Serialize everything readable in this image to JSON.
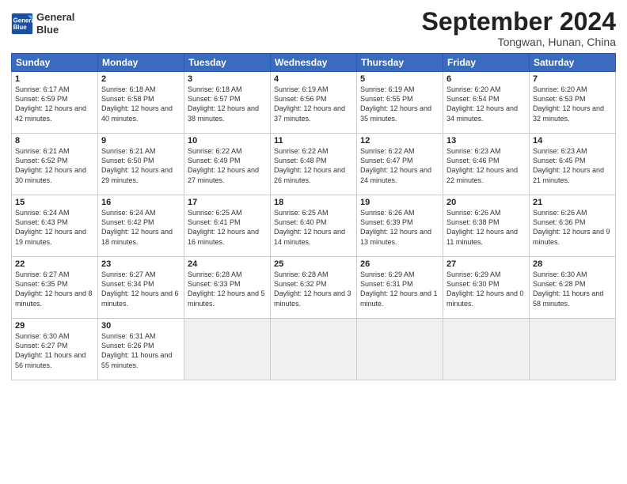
{
  "header": {
    "logo_line1": "General",
    "logo_line2": "Blue",
    "month_title": "September 2024",
    "location": "Tongwan, Hunan, China"
  },
  "days_of_week": [
    "Sunday",
    "Monday",
    "Tuesday",
    "Wednesday",
    "Thursday",
    "Friday",
    "Saturday"
  ],
  "weeks": [
    [
      {
        "day": "1",
        "sunrise": "6:17 AM",
        "sunset": "6:59 PM",
        "daylight": "12 hours and 42 minutes."
      },
      {
        "day": "2",
        "sunrise": "6:18 AM",
        "sunset": "6:58 PM",
        "daylight": "12 hours and 40 minutes."
      },
      {
        "day": "3",
        "sunrise": "6:18 AM",
        "sunset": "6:57 PM",
        "daylight": "12 hours and 38 minutes."
      },
      {
        "day": "4",
        "sunrise": "6:19 AM",
        "sunset": "6:56 PM",
        "daylight": "12 hours and 37 minutes."
      },
      {
        "day": "5",
        "sunrise": "6:19 AM",
        "sunset": "6:55 PM",
        "daylight": "12 hours and 35 minutes."
      },
      {
        "day": "6",
        "sunrise": "6:20 AM",
        "sunset": "6:54 PM",
        "daylight": "12 hours and 34 minutes."
      },
      {
        "day": "7",
        "sunrise": "6:20 AM",
        "sunset": "6:53 PM",
        "daylight": "12 hours and 32 minutes."
      }
    ],
    [
      {
        "day": "8",
        "sunrise": "6:21 AM",
        "sunset": "6:52 PM",
        "daylight": "12 hours and 30 minutes."
      },
      {
        "day": "9",
        "sunrise": "6:21 AM",
        "sunset": "6:50 PM",
        "daylight": "12 hours and 29 minutes."
      },
      {
        "day": "10",
        "sunrise": "6:22 AM",
        "sunset": "6:49 PM",
        "daylight": "12 hours and 27 minutes."
      },
      {
        "day": "11",
        "sunrise": "6:22 AM",
        "sunset": "6:48 PM",
        "daylight": "12 hours and 26 minutes."
      },
      {
        "day": "12",
        "sunrise": "6:22 AM",
        "sunset": "6:47 PM",
        "daylight": "12 hours and 24 minutes."
      },
      {
        "day": "13",
        "sunrise": "6:23 AM",
        "sunset": "6:46 PM",
        "daylight": "12 hours and 22 minutes."
      },
      {
        "day": "14",
        "sunrise": "6:23 AM",
        "sunset": "6:45 PM",
        "daylight": "12 hours and 21 minutes."
      }
    ],
    [
      {
        "day": "15",
        "sunrise": "6:24 AM",
        "sunset": "6:43 PM",
        "daylight": "12 hours and 19 minutes."
      },
      {
        "day": "16",
        "sunrise": "6:24 AM",
        "sunset": "6:42 PM",
        "daylight": "12 hours and 18 minutes."
      },
      {
        "day": "17",
        "sunrise": "6:25 AM",
        "sunset": "6:41 PM",
        "daylight": "12 hours and 16 minutes."
      },
      {
        "day": "18",
        "sunrise": "6:25 AM",
        "sunset": "6:40 PM",
        "daylight": "12 hours and 14 minutes."
      },
      {
        "day": "19",
        "sunrise": "6:26 AM",
        "sunset": "6:39 PM",
        "daylight": "12 hours and 13 minutes."
      },
      {
        "day": "20",
        "sunrise": "6:26 AM",
        "sunset": "6:38 PM",
        "daylight": "12 hours and 11 minutes."
      },
      {
        "day": "21",
        "sunrise": "6:26 AM",
        "sunset": "6:36 PM",
        "daylight": "12 hours and 9 minutes."
      }
    ],
    [
      {
        "day": "22",
        "sunrise": "6:27 AM",
        "sunset": "6:35 PM",
        "daylight": "12 hours and 8 minutes."
      },
      {
        "day": "23",
        "sunrise": "6:27 AM",
        "sunset": "6:34 PM",
        "daylight": "12 hours and 6 minutes."
      },
      {
        "day": "24",
        "sunrise": "6:28 AM",
        "sunset": "6:33 PM",
        "daylight": "12 hours and 5 minutes."
      },
      {
        "day": "25",
        "sunrise": "6:28 AM",
        "sunset": "6:32 PM",
        "daylight": "12 hours and 3 minutes."
      },
      {
        "day": "26",
        "sunrise": "6:29 AM",
        "sunset": "6:31 PM",
        "daylight": "12 hours and 1 minute."
      },
      {
        "day": "27",
        "sunrise": "6:29 AM",
        "sunset": "6:30 PM",
        "daylight": "12 hours and 0 minutes."
      },
      {
        "day": "28",
        "sunrise": "6:30 AM",
        "sunset": "6:28 PM",
        "daylight": "11 hours and 58 minutes."
      }
    ],
    [
      {
        "day": "29",
        "sunrise": "6:30 AM",
        "sunset": "6:27 PM",
        "daylight": "11 hours and 56 minutes."
      },
      {
        "day": "30",
        "sunrise": "6:31 AM",
        "sunset": "6:26 PM",
        "daylight": "11 hours and 55 minutes."
      },
      {
        "day": "",
        "sunrise": "",
        "sunset": "",
        "daylight": ""
      },
      {
        "day": "",
        "sunrise": "",
        "sunset": "",
        "daylight": ""
      },
      {
        "day": "",
        "sunrise": "",
        "sunset": "",
        "daylight": ""
      },
      {
        "day": "",
        "sunrise": "",
        "sunset": "",
        "daylight": ""
      },
      {
        "day": "",
        "sunrise": "",
        "sunset": "",
        "daylight": ""
      }
    ]
  ]
}
